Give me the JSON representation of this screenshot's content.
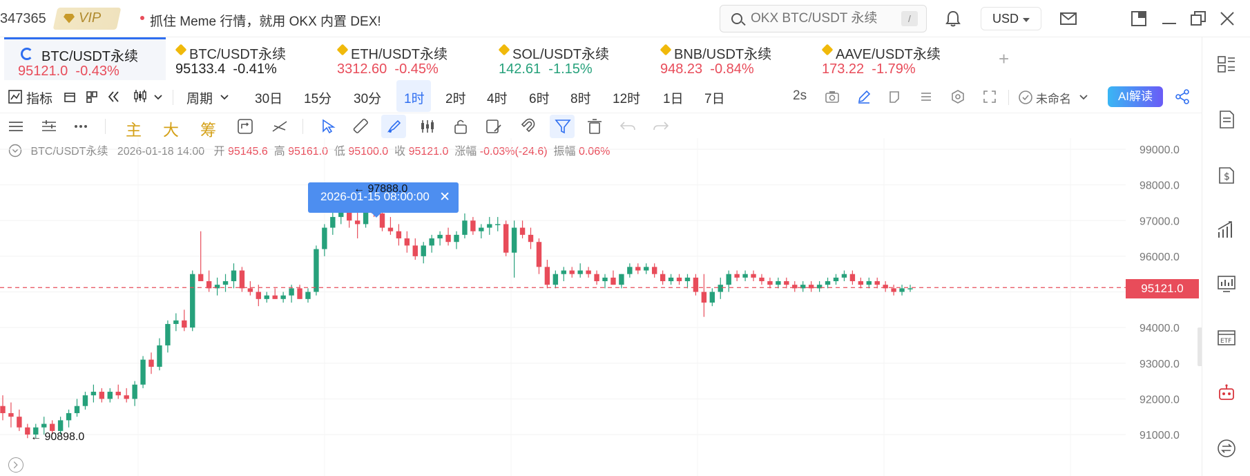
{
  "topbar": {
    "account": "347365",
    "vip_label": "VIP",
    "news": "抓住 Meme 行情，就用 OKX 内置 DEX!",
    "search_placeholder": "OKX BTC/USDT 永续",
    "search_shortcut": "/",
    "currency": "USD"
  },
  "tabs": [
    {
      "name": "BTC/USDT永续",
      "price": "95121.0",
      "change": "-0.43%",
      "color": "red",
      "active": true
    },
    {
      "name": "BTC/USDT永续",
      "price": "95133.4",
      "change": "-0.41%",
      "color": "dark",
      "active": false
    },
    {
      "name": "ETH/USDT永续",
      "price": "3312.60",
      "change": "-0.45%",
      "color": "red",
      "active": false
    },
    {
      "name": "SOL/USDT永续",
      "price": "142.61",
      "change": "-1.15%",
      "color": "green",
      "active": false
    },
    {
      "name": "BNB/USDT永续",
      "price": "948.23",
      "change": "-0.84%",
      "color": "red",
      "active": false
    },
    {
      "name": "AAVE/USDT永续",
      "price": "173.22",
      "change": "-1.79%",
      "color": "red",
      "active": false
    }
  ],
  "toolbar": {
    "indicators": "指标",
    "period_label": "周期",
    "periods": [
      "30日",
      "15分",
      "30分",
      "1时",
      "2时",
      "4时",
      "6时",
      "8时",
      "12时",
      "1日",
      "7日"
    ],
    "active_period": "1时",
    "refresh": "2s",
    "layout_name": "未命名",
    "ai_button": "AI解读"
  },
  "drawing_tools": {
    "main": "主",
    "large": "大",
    "chips": "筹"
  },
  "info_bar": {
    "symbol": "BTC/USDT永续",
    "time": "2026-01-18 14:00",
    "open_label": "开",
    "open": "95145.6",
    "high_label": "高",
    "high": "95161.0",
    "low_label": "低",
    "low": "95100.0",
    "close_label": "收",
    "close": "95121.0",
    "change_label": "涨幅",
    "change": "-0.03%(-24.6)",
    "amp_label": "振幅",
    "amp": "0.06%"
  },
  "tooltip": {
    "text": "2026-01-15 08:00:00",
    "close": "✕"
  },
  "markers": {
    "high": "← 97888.0",
    "low": "← 90898.0"
  },
  "current_price": "95121.0",
  "colors": {
    "up": "#26a17b",
    "down": "#e84c5a",
    "accent": "#2e6ef0"
  },
  "chart_data": {
    "type": "candlestick",
    "title": "",
    "y_ticks": [
      "99000.0",
      "98000.0",
      "97000.0",
      "96000.0",
      "95000.0",
      "94000.0",
      "93000.0",
      "92000.0",
      "91000.0"
    ],
    "ylim": [
      90800,
      99300
    ],
    "current_price": 95121.0,
    "candles": [
      [
        91800,
        92100,
        91400,
        91600
      ],
      [
        91600,
        91900,
        91200,
        91500
      ],
      [
        91500,
        91700,
        91100,
        91200
      ],
      [
        91200,
        91300,
        90898,
        91000
      ],
      [
        91000,
        91300,
        90900,
        91200
      ],
      [
        91200,
        91500,
        91000,
        91300
      ],
      [
        91300,
        91400,
        91000,
        91100
      ],
      [
        91100,
        91500,
        91000,
        91400
      ],
      [
        91400,
        91700,
        91200,
        91600
      ],
      [
        91600,
        92000,
        91500,
        91800
      ],
      [
        91800,
        92200,
        91700,
        92100
      ],
      [
        92100,
        92400,
        91900,
        92200
      ],
      [
        92200,
        92300,
        91900,
        92000
      ],
      [
        92000,
        92300,
        91900,
        92200
      ],
      [
        92200,
        92400,
        92000,
        92100
      ],
      [
        92100,
        92300,
        91900,
        92000
      ],
      [
        92000,
        92500,
        91800,
        92400
      ],
      [
        92400,
        93200,
        92300,
        93100
      ],
      [
        93100,
        93300,
        92700,
        92900
      ],
      [
        92900,
        93700,
        92800,
        93500
      ],
      [
        93500,
        94200,
        93300,
        94100
      ],
      [
        94100,
        94400,
        93900,
        94200
      ],
      [
        94200,
        94500,
        93900,
        94000
      ],
      [
        94000,
        95600,
        93900,
        95500
      ],
      [
        95500,
        96700,
        95400,
        95300
      ],
      [
        95300,
        95600,
        95000,
        95100
      ],
      [
        95100,
        95400,
        94900,
        95200
      ],
      [
        95200,
        95500,
        95000,
        95300
      ],
      [
        95300,
        95800,
        95100,
        95600
      ],
      [
        95600,
        95700,
        95000,
        95100
      ],
      [
        95100,
        95300,
        94900,
        95000
      ],
      [
        95000,
        95200,
        94600,
        94800
      ],
      [
        94800,
        95000,
        94700,
        94900
      ],
      [
        94900,
        95100,
        94800,
        94800
      ],
      [
        94800,
        95000,
        94700,
        94900
      ],
      [
        94900,
        95200,
        94700,
        95100
      ],
      [
        95100,
        95200,
        94800,
        94800
      ],
      [
        94800,
        95100,
        94700,
        95000
      ],
      [
        95000,
        96300,
        94900,
        96200
      ],
      [
        96200,
        96900,
        96000,
        96800
      ],
      [
        96800,
        97300,
        96600,
        97100
      ],
      [
        97100,
        97500,
        96900,
        97300
      ],
      [
        97300,
        97700,
        96800,
        97000
      ],
      [
        97000,
        97400,
        96500,
        96900
      ],
      [
        96900,
        97700,
        96800,
        97500
      ],
      [
        97500,
        97888,
        97100,
        97200
      ],
      [
        97200,
        97400,
        96700,
        96800
      ],
      [
        96800,
        97100,
        96600,
        96700
      ],
      [
        96700,
        96900,
        96300,
        96500
      ],
      [
        96500,
        96700,
        96100,
        96300
      ],
      [
        96300,
        96500,
        95900,
        96000
      ],
      [
        96000,
        96400,
        95800,
        96300
      ],
      [
        96300,
        96600,
        96100,
        96500
      ],
      [
        96500,
        96700,
        96300,
        96600
      ],
      [
        96600,
        96800,
        96300,
        96400
      ],
      [
        96400,
        96700,
        96200,
        96600
      ],
      [
        96600,
        97200,
        96500,
        97000
      ],
      [
        97000,
        97100,
        96600,
        96700
      ],
      [
        96700,
        96900,
        96500,
        96800
      ],
      [
        96800,
        97100,
        96600,
        96900
      ],
      [
        96900,
        97100,
        96700,
        96900
      ],
      [
        96900,
        97000,
        96000,
        96100
      ],
      [
        96100,
        97000,
        95400,
        96800
      ],
      [
        96800,
        97000,
        96500,
        96600
      ],
      [
        96600,
        96800,
        96200,
        96400
      ],
      [
        96400,
        96500,
        95500,
        95700
      ],
      [
        95700,
        95900,
        95100,
        95200
      ],
      [
        95200,
        95600,
        95100,
        95500
      ],
      [
        95500,
        95700,
        95300,
        95600
      ],
      [
        95600,
        95700,
        95400,
        95500
      ],
      [
        95500,
        95800,
        95400,
        95600
      ],
      [
        95600,
        95700,
        95400,
        95500
      ],
      [
        95500,
        95600,
        95200,
        95300
      ],
      [
        95300,
        95500,
        95100,
        95400
      ],
      [
        95400,
        95600,
        95200,
        95200
      ],
      [
        95200,
        95500,
        95100,
        95500
      ],
      [
        95500,
        95800,
        95400,
        95700
      ],
      [
        95700,
        95800,
        95500,
        95600
      ],
      [
        95600,
        95800,
        95500,
        95700
      ],
      [
        95700,
        95800,
        95400,
        95500
      ],
      [
        95500,
        95600,
        95200,
        95300
      ],
      [
        95300,
        95500,
        95200,
        95400
      ],
      [
        95400,
        95500,
        95200,
        95300
      ],
      [
        95300,
        95500,
        95100,
        95400
      ],
      [
        95400,
        95500,
        94900,
        95000
      ],
      [
        95000,
        95500,
        94300,
        94700
      ],
      [
        94700,
        95100,
        94600,
        95000
      ],
      [
        95000,
        95400,
        94800,
        95200
      ],
      [
        95200,
        95600,
        95000,
        95500
      ],
      [
        95500,
        95600,
        95300,
        95400
      ],
      [
        95400,
        95600,
        95300,
        95500
      ],
      [
        95500,
        95600,
        95300,
        95400
      ],
      [
        95400,
        95500,
        95200,
        95300
      ],
      [
        95300,
        95400,
        95100,
        95200
      ],
      [
        95200,
        95400,
        95100,
        95300
      ],
      [
        95300,
        95400,
        95100,
        95200
      ],
      [
        95200,
        95300,
        95000,
        95100
      ],
      [
        95100,
        95300,
        95000,
        95200
      ],
      [
        95200,
        95300,
        95000,
        95100
      ],
      [
        95100,
        95300,
        95000,
        95200
      ],
      [
        95200,
        95400,
        95100,
        95300
      ],
      [
        95300,
        95500,
        95200,
        95400
      ],
      [
        95400,
        95600,
        95300,
        95500
      ],
      [
        95500,
        95600,
        95200,
        95300
      ],
      [
        95300,
        95400,
        95100,
        95200
      ],
      [
        95200,
        95400,
        95100,
        95300
      ],
      [
        95300,
        95400,
        95100,
        95200
      ],
      [
        95200,
        95300,
        95000,
        95100
      ],
      [
        95100,
        95200,
        94900,
        95000
      ],
      [
        95000,
        95200,
        94900,
        95100
      ],
      [
        95100,
        95200,
        95000,
        95100
      ]
    ]
  }
}
